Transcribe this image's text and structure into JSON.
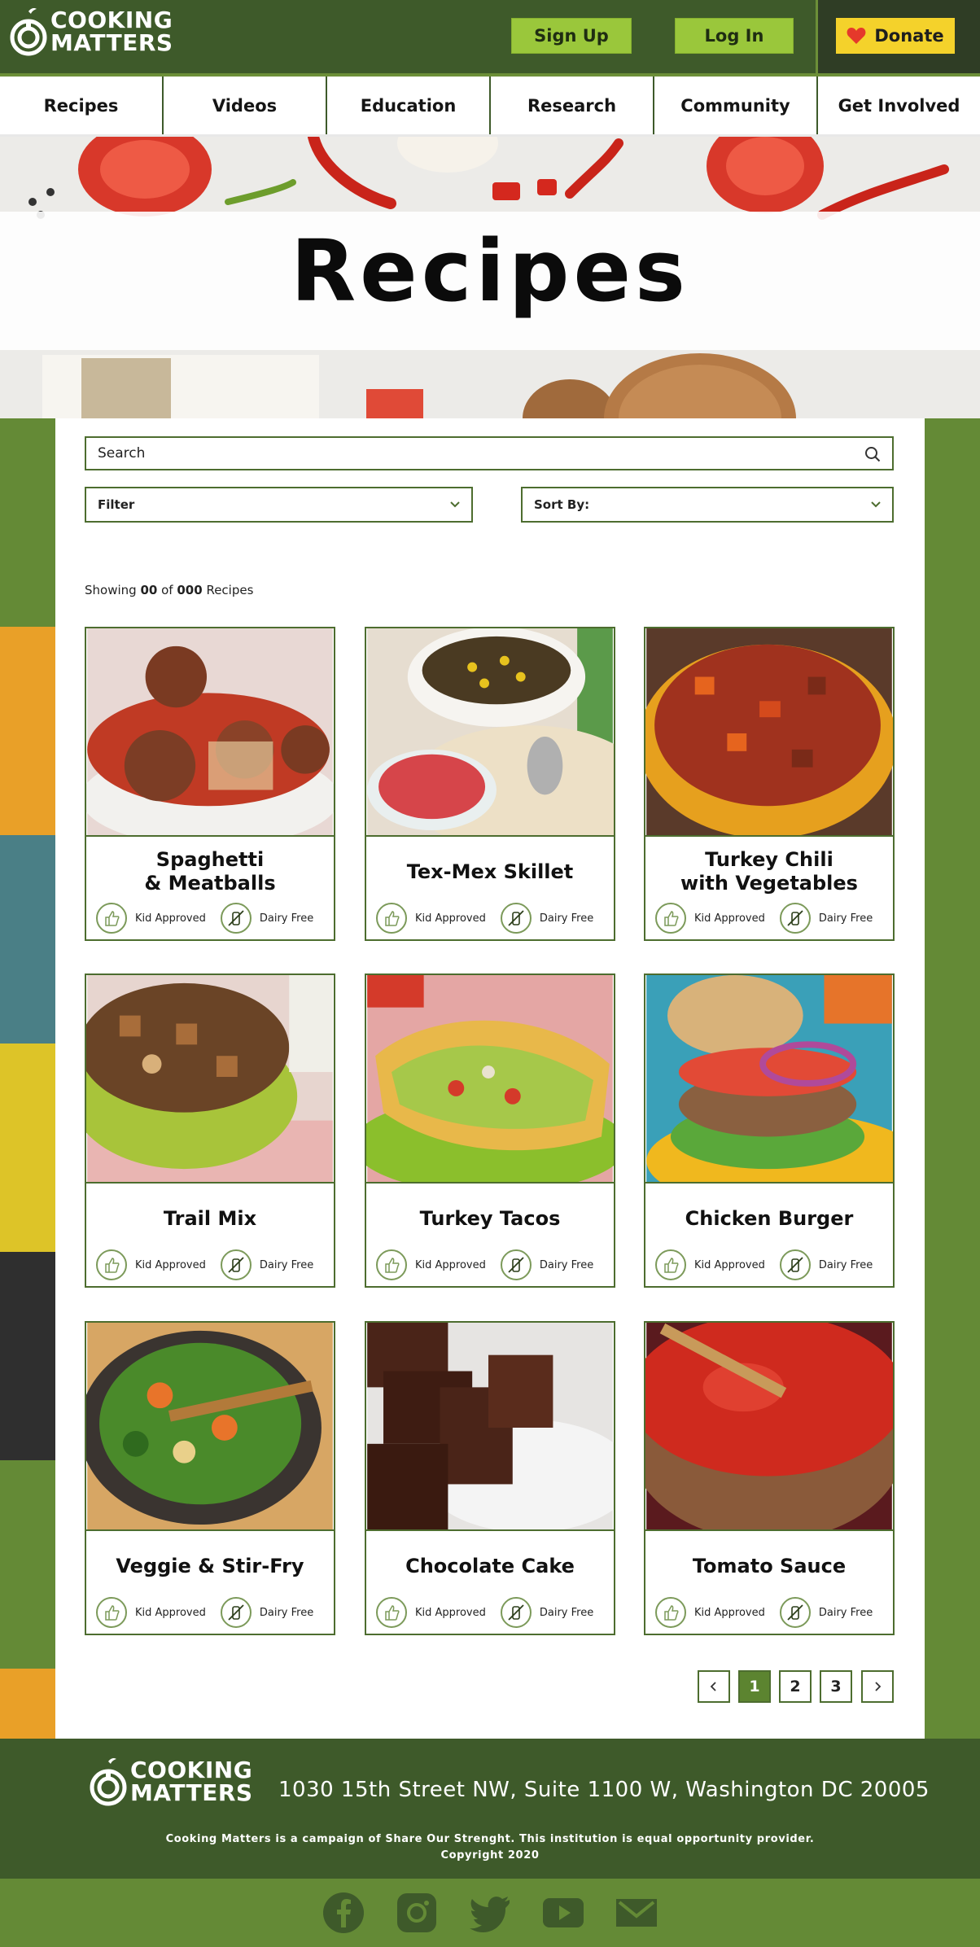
{
  "brand": {
    "line1": "COOKING",
    "line2": "MATTERS"
  },
  "header": {
    "signup": "Sign Up",
    "login": "Log In",
    "donate": "Donate"
  },
  "nav": [
    "Recipes",
    "Videos",
    "Education",
    "Research",
    "Community",
    "Get Involved"
  ],
  "hero": {
    "title": "Recipes"
  },
  "search": {
    "placeholder": "Search"
  },
  "filter": {
    "label": "Filter"
  },
  "sort": {
    "label": "Sort By:"
  },
  "showing": {
    "prefix": "Showing",
    "count": "00",
    "of": "of",
    "total": "000",
    "suffix": "Recipes"
  },
  "tags": {
    "kid": "Kid Approved",
    "dairy": "Dairy Free"
  },
  "recipes": [
    {
      "title": "Spaghetti\n& Meatballs"
    },
    {
      "title": "Tex-Mex Skillet"
    },
    {
      "title": "Turkey Chili\nwith Vegetables"
    },
    {
      "title": "Trail Mix"
    },
    {
      "title": "Turkey Tacos"
    },
    {
      "title": "Chicken Burger"
    },
    {
      "title": "Veggie & Stir-Fry"
    },
    {
      "title": "Chocolate Cake"
    },
    {
      "title": "Tomato Sauce"
    }
  ],
  "pagination": {
    "pages": [
      "1",
      "2",
      "3"
    ],
    "current": "1"
  },
  "footer": {
    "address": "1030 15th Street NW, Suite 1100 W, Washington DC 20005",
    "note": "Cooking Matters is a campaign of Share Our Strenght. This institution is equal opportunity provider.",
    "copyright": "Copyright 2020"
  },
  "social": [
    "facebook-icon",
    "instagram-icon",
    "twitter-icon",
    "youtube-icon",
    "email-icon"
  ],
  "colors": {
    "dark_green": "#3e5a2a",
    "accent_green": "#9ac73b",
    "donate_yellow": "#f4d22b",
    "side_green": "#648a36"
  }
}
